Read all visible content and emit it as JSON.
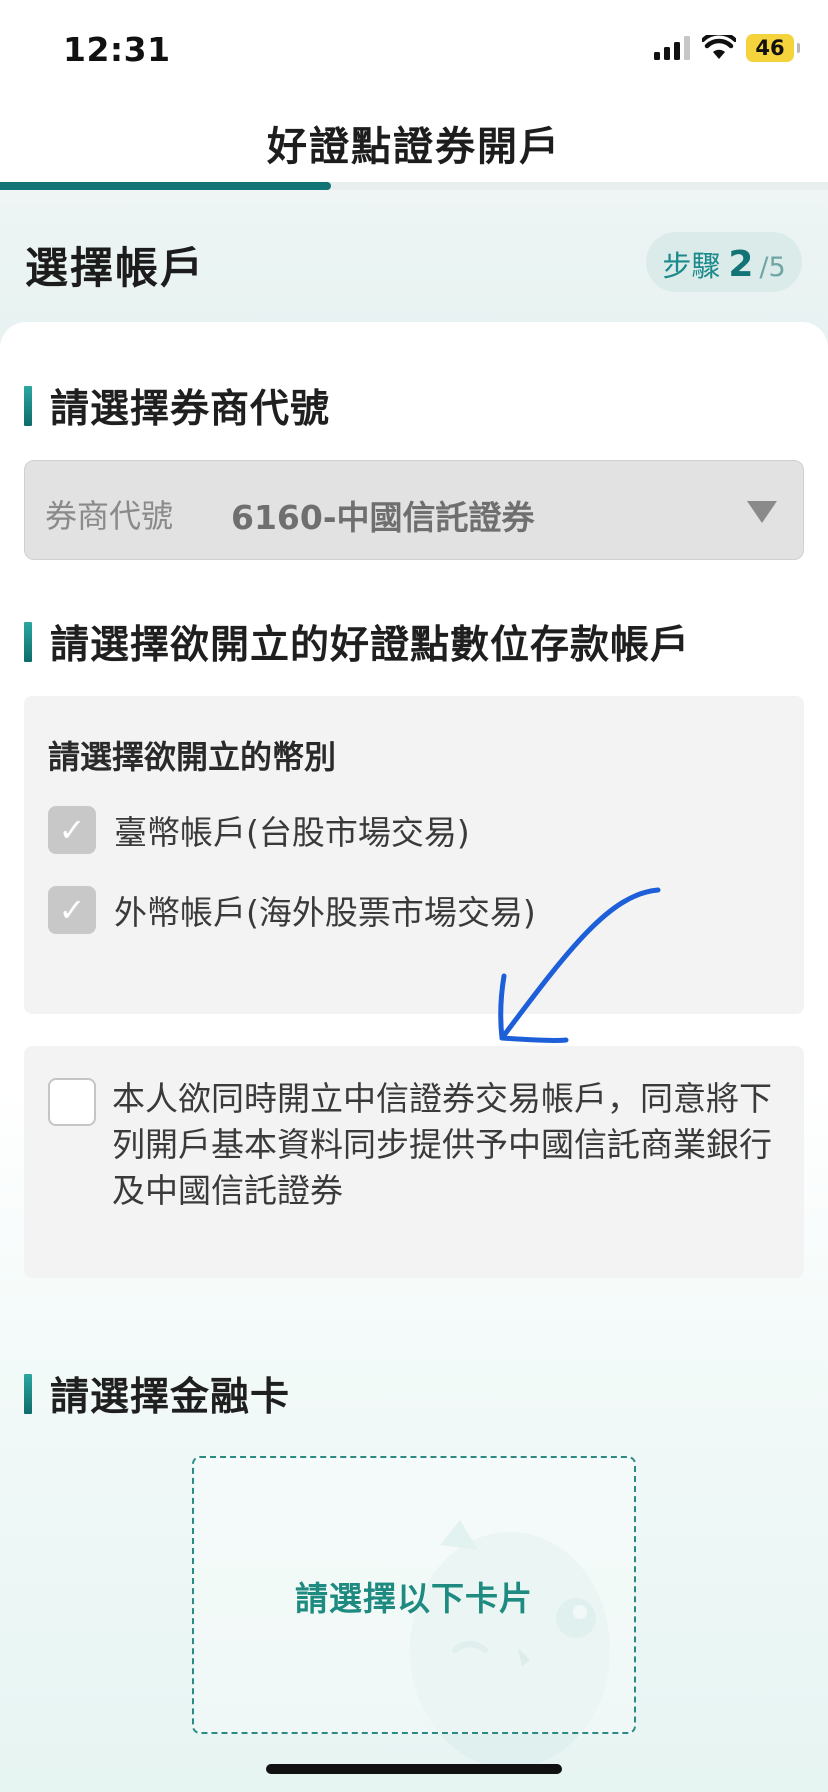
{
  "status_bar": {
    "time": "12:31",
    "battery": "46"
  },
  "nav": {
    "title": "好證點證券開戶"
  },
  "progress": {
    "step_fraction": 0.4
  },
  "header": {
    "title": "選擇帳戶",
    "step_label": "步驟",
    "step_current": "2",
    "step_total": "/5"
  },
  "broker_section": {
    "title": "請選擇券商代號",
    "select_label": "券商代號",
    "select_value": "6160-中國信託證券"
  },
  "account_section": {
    "title": "請選擇欲開立的好證點數位存款帳戶",
    "currency_heading": "請選擇欲開立的幣別",
    "options": [
      {
        "label": "臺幣帳戶(台股市場交易)",
        "checked": true
      },
      {
        "label": "外幣帳戶(海外股票市場交易)",
        "checked": true
      }
    ],
    "consent": {
      "text": "本人欲同時開立中信證券交易帳戶，同意將下列開戶基本資料同步提供予中國信託商業銀行及中國信託證券",
      "checked": false
    }
  },
  "card_section": {
    "title": "請選擇金融卡",
    "placeholder": "請選擇以下卡片"
  },
  "colors": {
    "accent": "#127474",
    "annotation_arrow": "#1d5ed9"
  }
}
